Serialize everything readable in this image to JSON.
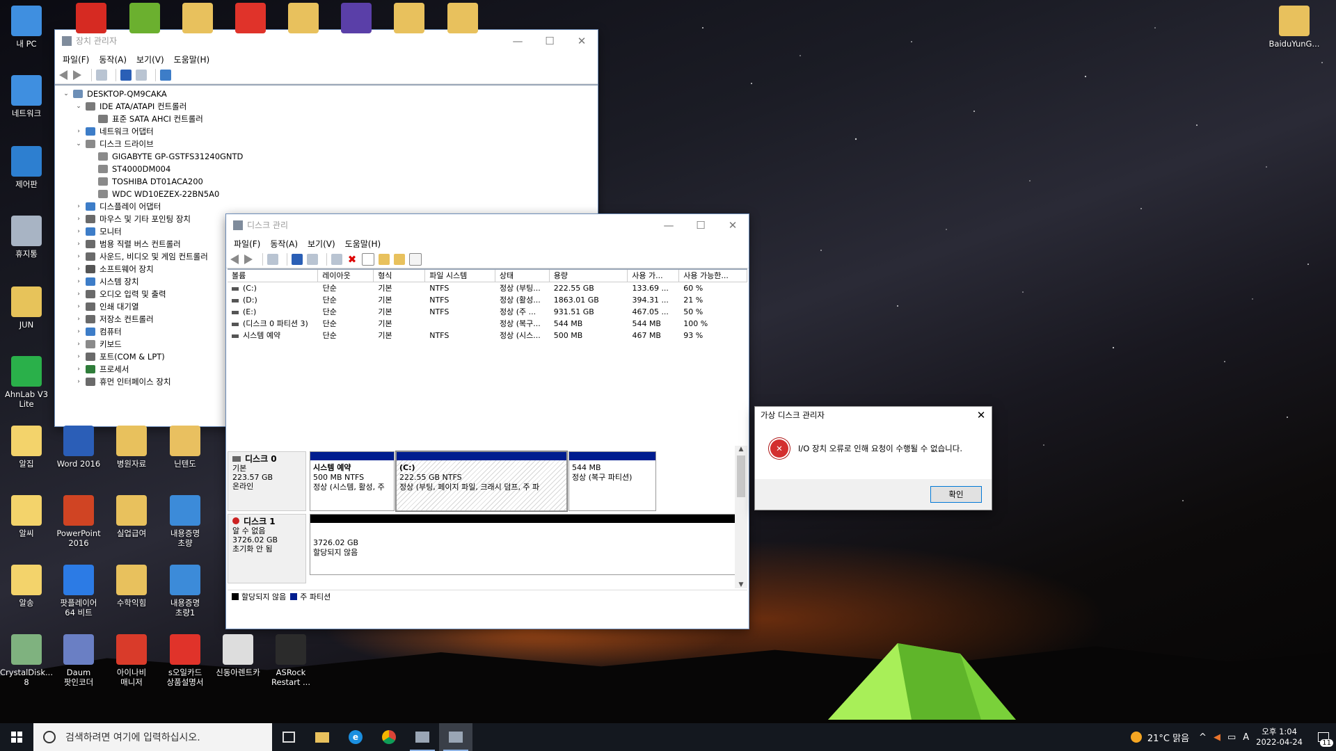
{
  "desktop": {
    "left_icons": [
      {
        "label": "내 PC",
        "icon": "pc-icon",
        "color": "#3f8fe0"
      },
      {
        "label": "네트워크",
        "icon": "network-icon",
        "color": "#3f8fe0"
      },
      {
        "label": "제어판",
        "icon": "control-panel-icon",
        "color": "#2d7fd0"
      },
      {
        "label": "휴지통",
        "icon": "recycle-bin-icon",
        "color": "#a8b4c4"
      },
      {
        "label": "JUN",
        "icon": "user-folder-icon",
        "color": "#e7c35a"
      },
      {
        "label": "AhnLab V3\nLite",
        "icon": "ahnlab-v3-icon",
        "color": "#2ab04a"
      },
      {
        "label": "알집",
        "icon": "alzip-icon",
        "color": "#f3d36b"
      },
      {
        "label": "알씨",
        "icon": "alsee-icon",
        "color": "#f3d36b"
      },
      {
        "label": "알송",
        "icon": "alsong-icon",
        "color": "#f3d36b"
      },
      {
        "label": "CrystalDisk...\n8",
        "icon": "crystaldisk-icon",
        "color": "#7fb27f"
      }
    ],
    "grid_icons": [
      {
        "label": "Word 2016",
        "icon": "word-icon",
        "color": "#2b5eb7"
      },
      {
        "label": "병원자료",
        "icon": "folder-icon",
        "color": "#e8c15d"
      },
      {
        "label": "닌텐도",
        "icon": "pdf-folder-icon",
        "color": "#e9c060"
      },
      {
        "label": "PowerPoint\n2016",
        "icon": "powerpoint-icon",
        "color": "#d04423"
      },
      {
        "label": "실업급여",
        "icon": "folder-icon",
        "color": "#e8c15d"
      },
      {
        "label": "내용증명\n초량",
        "icon": "edge-doc-icon",
        "color": "#3c8bd9"
      },
      {
        "label": "팟플레이어\n64 비트",
        "icon": "potplayer-icon",
        "color": "#2c7be5"
      },
      {
        "label": "수학익힘",
        "icon": "folder-icon",
        "color": "#e8c15d"
      },
      {
        "label": "내용증명\n초량1",
        "icon": "edge-doc-icon",
        "color": "#3c8bd9"
      },
      {
        "label": "Daum\n팟인코더",
        "icon": "daum-encoder-icon",
        "color": "#6a7fc4"
      },
      {
        "label": "아이나비\n매니저",
        "icon": "inavi-icon",
        "color": "#d93b2a"
      },
      {
        "label": "s오일카드\n상품설명서",
        "icon": "pdf-icon",
        "color": "#e0332a"
      },
      {
        "label": "신동아렌트카",
        "icon": "shortcut-icon",
        "color": "#dddddd"
      },
      {
        "label": "ASRock\nRestart ...",
        "icon": "asrock-uefi-icon",
        "color": "#2b2b2b"
      }
    ],
    "top_icons": [
      {
        "icon": "acrobat-icon",
        "color": "#d62a22"
      },
      {
        "icon": "utorrent-icon",
        "color": "#6bb02f"
      },
      {
        "icon": "folder-icon",
        "color": "#e8c15d"
      },
      {
        "icon": "pdf-icon",
        "color": "#e0332a"
      },
      {
        "icon": "folder-icon",
        "color": "#e8c15d"
      },
      {
        "icon": "cpu-icon",
        "color": "#5a3fa8"
      },
      {
        "icon": "folder-icon",
        "color": "#e8c15d"
      },
      {
        "icon": "folder-icon",
        "color": "#e8c15d"
      }
    ],
    "right_icon": {
      "label": "BaiduYunG...",
      "icon": "baidu-folder-icon",
      "color": "#e8c15d"
    }
  },
  "device_manager": {
    "title": "장치 관리자",
    "menu": [
      "파일(F)",
      "동작(A)",
      "보기(V)",
      "도움말(H)"
    ],
    "tree": [
      {
        "level": 0,
        "toggle": "v",
        "label": "DESKTOP-QM9CAKA",
        "icon": "computer-icon",
        "color": "#6d8fb7"
      },
      {
        "level": 1,
        "toggle": "v",
        "label": "IDE ATA/ATAPI 컨트롤러",
        "icon": "controller-icon",
        "color": "#7a7a7a"
      },
      {
        "level": 2,
        "toggle": "",
        "label": "표준 SATA AHCI 컨트롤러",
        "icon": "controller-icon",
        "color": "#7a7a7a"
      },
      {
        "level": 1,
        "toggle": ">",
        "label": "네트워크 어댑터",
        "icon": "network-adapter-icon",
        "color": "#3d7dc8"
      },
      {
        "level": 1,
        "toggle": "v",
        "label": "디스크 드라이브",
        "icon": "disk-drive-icon",
        "color": "#8a8a8a"
      },
      {
        "level": 2,
        "toggle": "",
        "label": "GIGABYTE GP-GSTFS31240GNTD",
        "icon": "disk-drive-icon",
        "color": "#8a8a8a"
      },
      {
        "level": 2,
        "toggle": "",
        "label": "ST4000DM004",
        "icon": "disk-drive-icon",
        "color": "#8a8a8a"
      },
      {
        "level": 2,
        "toggle": "",
        "label": "TOSHIBA DT01ACA200",
        "icon": "disk-drive-icon",
        "color": "#8a8a8a"
      },
      {
        "level": 2,
        "toggle": "",
        "label": "WDC WD10EZEX-22BN5A0",
        "icon": "disk-drive-icon",
        "color": "#8a8a8a"
      },
      {
        "level": 1,
        "toggle": ">",
        "label": "디스플레이 어댑터",
        "icon": "display-adapter-icon",
        "color": "#3d7dc8"
      },
      {
        "level": 1,
        "toggle": ">",
        "label": "마우스 및 기타 포인팅 장치",
        "icon": "mouse-icon",
        "color": "#6a6a6a"
      },
      {
        "level": 1,
        "toggle": ">",
        "label": "모니터",
        "icon": "monitor-icon",
        "color": "#3d7dc8"
      },
      {
        "level": 1,
        "toggle": ">",
        "label": "범용 직렬 버스 컨트롤러",
        "icon": "usb-icon",
        "color": "#6a6a6a"
      },
      {
        "level": 1,
        "toggle": ">",
        "label": "사운드, 비디오 및 게임 컨트롤러",
        "icon": "speaker-icon",
        "color": "#6a6a6a"
      },
      {
        "level": 1,
        "toggle": ">",
        "label": "소프트웨어 장치",
        "icon": "software-device-icon",
        "color": "#555555"
      },
      {
        "level": 1,
        "toggle": ">",
        "label": "시스템 장치",
        "icon": "system-device-icon",
        "color": "#3d7dc8"
      },
      {
        "level": 1,
        "toggle": ">",
        "label": "오디오 입력 및 출력",
        "icon": "audio-icon",
        "color": "#6a6a6a"
      },
      {
        "level": 1,
        "toggle": ">",
        "label": "인쇄 대기열",
        "icon": "printer-icon",
        "color": "#6a6a6a"
      },
      {
        "level": 1,
        "toggle": ">",
        "label": "저장소 컨트롤러",
        "icon": "storage-controller-icon",
        "color": "#6a6a6a"
      },
      {
        "level": 1,
        "toggle": ">",
        "label": "컴퓨터",
        "icon": "computer-icon",
        "color": "#3d7dc8"
      },
      {
        "level": 1,
        "toggle": ">",
        "label": "키보드",
        "icon": "keyboard-icon",
        "color": "#8a8a8a"
      },
      {
        "level": 1,
        "toggle": ">",
        "label": "포트(COM & LPT)",
        "icon": "port-icon",
        "color": "#6a6a6a"
      },
      {
        "level": 1,
        "toggle": ">",
        "label": "프로세서",
        "icon": "processor-icon",
        "color": "#2f7d3a"
      },
      {
        "level": 1,
        "toggle": ">",
        "label": "휴먼 인터페이스 장치",
        "icon": "hid-icon",
        "color": "#6a6a6a"
      }
    ]
  },
  "disk_management": {
    "title": "디스크 관리",
    "menu": [
      "파일(F)",
      "동작(A)",
      "보기(V)",
      "도움말(H)"
    ],
    "columns": [
      "볼륨",
      "레이아웃",
      "형식",
      "파일 시스템",
      "상태",
      "용량",
      "사용 가...",
      "사용 가능한..."
    ],
    "volumes": [
      [
        "(C:)",
        "단순",
        "기본",
        "NTFS",
        "정상 (부팅...",
        "222.55 GB",
        "133.69 ...",
        "60 %"
      ],
      [
        "(D:)",
        "단순",
        "기본",
        "NTFS",
        "정상 (활성...",
        "1863.01 GB",
        "394.31 ...",
        "21 %"
      ],
      [
        "(E:)",
        "단순",
        "기본",
        "NTFS",
        "정상 (주 ...",
        "931.51 GB",
        "467.05 ...",
        "50 %"
      ],
      [
        "(디스크 0 파티션 3)",
        "단순",
        "기본",
        "",
        "정상 (복구...",
        "544 MB",
        "544 MB",
        "100 %"
      ],
      [
        "시스템 예약",
        "단순",
        "기본",
        "NTFS",
        "정상 (시스...",
        "500 MB",
        "467 MB",
        "93 %"
      ]
    ],
    "disk0": {
      "name": "디스크 0",
      "type": "기본",
      "size": "223.57 GB",
      "status": "온라인",
      "partitions": [
        {
          "title": "시스템 예약",
          "line2": "500 MB NTFS",
          "line3": "정상 (시스템, 활성, 주"
        },
        {
          "title": "(C:)",
          "line2": "222.55 GB NTFS",
          "line3": "정상 (부팅, 페이지 파일, 크래시 덤프, 주 파"
        },
        {
          "title": "",
          "line2": "544 MB",
          "line3": "정상 (복구 파티션)"
        }
      ]
    },
    "disk1": {
      "name": "디스크 1",
      "type": "알 수 없음",
      "size": "3726.02 GB",
      "status": "초기화 안 됨",
      "part_size": "3726.02 GB",
      "part_status": "할당되지 않음"
    },
    "legend": [
      {
        "label": "할당되지 않음",
        "color": "#000000"
      },
      {
        "label": "주 파티션",
        "color": "#001d8f"
      }
    ]
  },
  "dialog": {
    "title": "가상 디스크 관리자",
    "message": "I/O 장치 오류로 인해 요청이 수행될 수 없습니다.",
    "ok": "확인"
  },
  "taskbar": {
    "search_placeholder": "검색하려면 여기에 입력하십시오.",
    "weather": "21°C  맑음",
    "ime": "A",
    "time": "오후 1:04",
    "date": "2022-04-24",
    "notifications": "11"
  },
  "colors": {
    "accent": "#0078d7",
    "primary_partition": "#001d8f",
    "unallocated": "#000000",
    "error": "#d32f2f"
  }
}
